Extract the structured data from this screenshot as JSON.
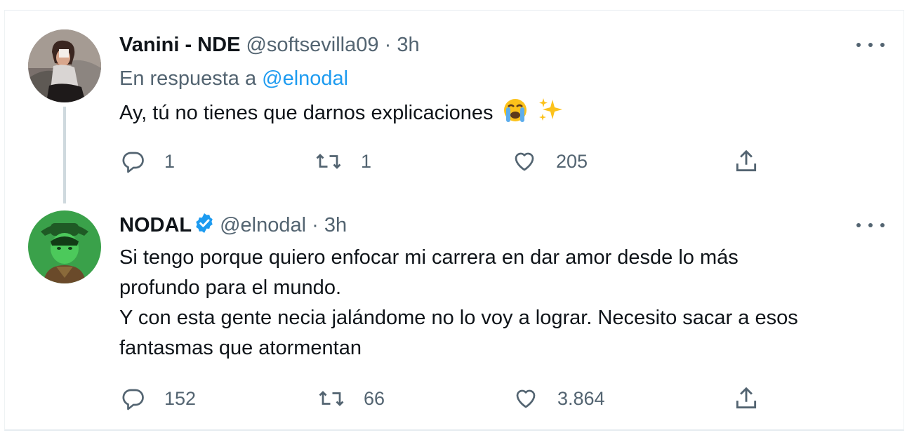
{
  "tweets": [
    {
      "name": "Vanini - NDE",
      "handle": "@softsevilla09",
      "separator": "·",
      "time": "3h",
      "reply_prefix": "En respuesta a",
      "reply_to": "@elnodal",
      "text": "Ay, tú no tienes que darnos explicaciones",
      "emojis": [
        "loudly-crying-face",
        "sparkles"
      ],
      "replies": "1",
      "retweets": "1",
      "likes": "205"
    },
    {
      "name": "NODAL",
      "verified": true,
      "handle": "@elnodal",
      "separator": "·",
      "time": "3h",
      "text_lines": [
        "Si tengo porque quiero enfocar mi carrera en dar amor desde lo más",
        "profundo para el mundo.",
        "Y con esta gente necia jalándome no lo voy a lograr. Necesito sacar a esos",
        "fantasmas que atormentan"
      ],
      "replies": "152",
      "retweets": "66",
      "likes": "3.864"
    }
  ],
  "colors": {
    "text": "#0f1419",
    "secondary": "#536471",
    "link": "#1d9bf0",
    "verified": "#1d9bf0",
    "thread_line": "#cfd9de"
  }
}
